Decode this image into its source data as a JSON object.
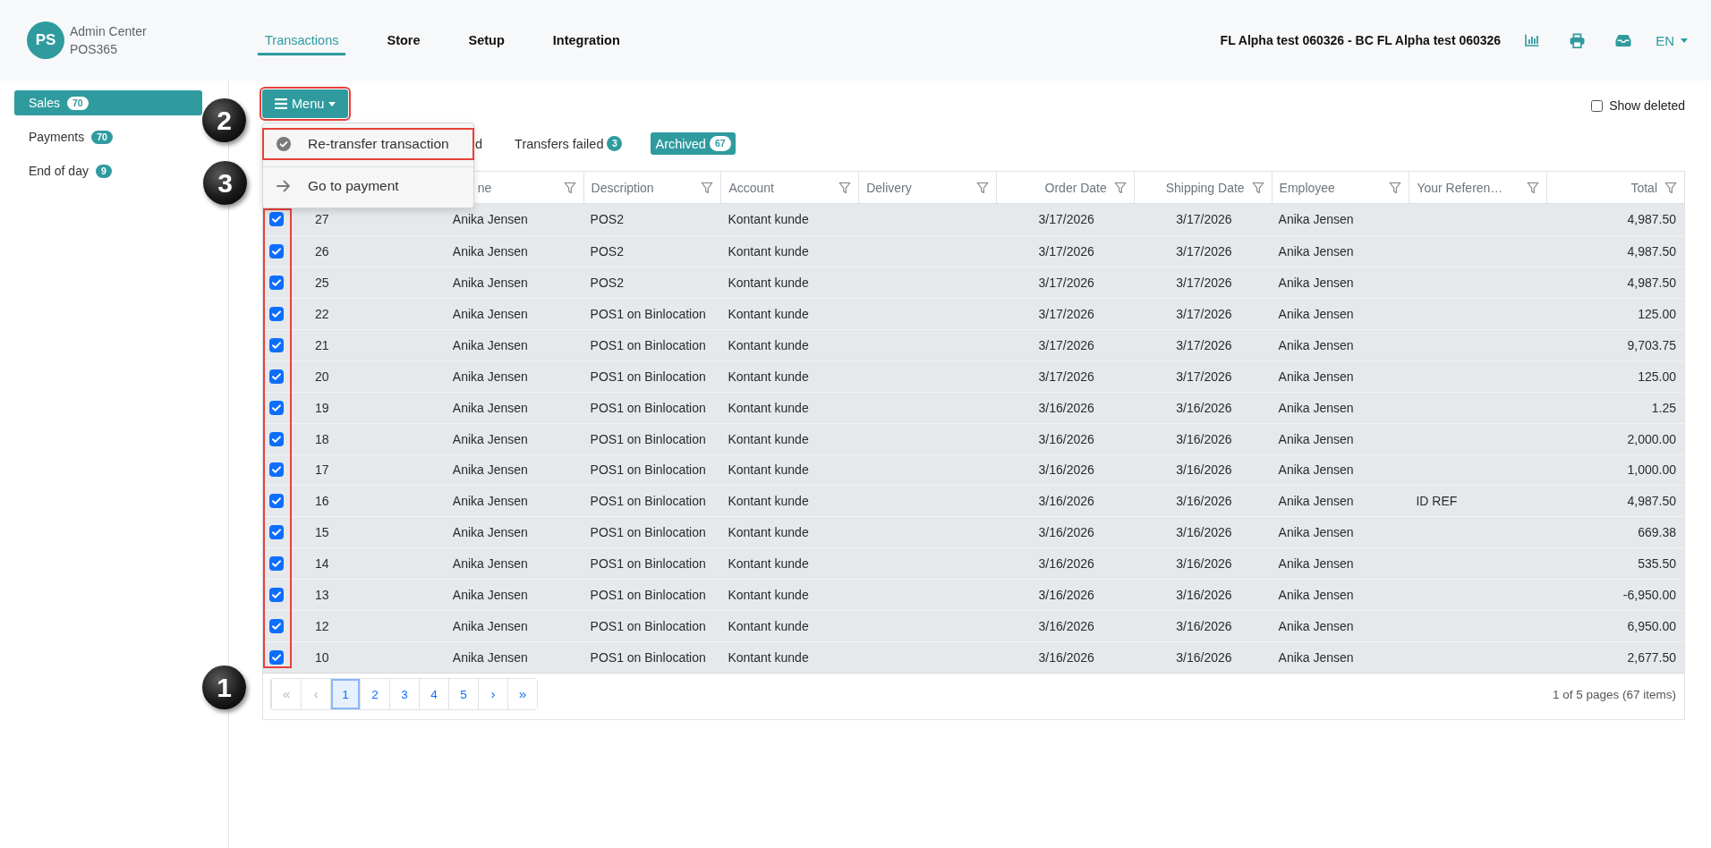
{
  "header": {
    "logo": {
      "initials": "PS",
      "title": "Admin Center",
      "subtitle": "POS365"
    },
    "nav": [
      {
        "label": "Transactions",
        "selected": true
      },
      {
        "label": "Store",
        "selected": false
      },
      {
        "label": "Setup",
        "selected": false
      },
      {
        "label": "Integration",
        "selected": false
      }
    ],
    "company": "FL Alpha test 060326 - BC FL Alpha test 060326",
    "language": "EN"
  },
  "sidebar": {
    "items": [
      {
        "label": "Sales",
        "count": "70",
        "selected": true
      },
      {
        "label": "Payments",
        "count": "70",
        "selected": false
      },
      {
        "label": "End of day",
        "count": "9",
        "selected": false
      }
    ]
  },
  "toolbar": {
    "menu_button": {
      "label": "Menu",
      "highlighted": true
    },
    "show_deleted": {
      "label": "Show deleted",
      "checked": false
    }
  },
  "menu": {
    "items": [
      {
        "kind": "confirm",
        "label": "Re-transfer transaction",
        "highlighted": true
      },
      {
        "kind": "navigate",
        "label": "Go to payment",
        "highlighted": false
      }
    ]
  },
  "tabs": [
    {
      "label": "d",
      "selected": false
    },
    {
      "label": "Transfers failed",
      "count": "3",
      "selected": false
    },
    {
      "label": "Archived",
      "count": "67",
      "selected": true
    }
  ],
  "table": {
    "columns": [
      {
        "label": "ne"
      },
      {
        "label": "Description"
      },
      {
        "label": "Account"
      },
      {
        "label": "Delivery"
      },
      {
        "label": "Order Date"
      },
      {
        "label": "Shipping Date"
      },
      {
        "label": "Employee"
      },
      {
        "label": "Your Referen…"
      },
      {
        "label": "Total"
      }
    ],
    "selection_highlighted": true,
    "rows": [
      {
        "checked": true,
        "column_2": "27",
        "column_3": "Anika Jensen",
        "description": "POS2",
        "account": "Kontant kunde",
        "order_date": "3/17/2026",
        "shipping_date": "3/17/2026",
        "employee": "Anika Jensen",
        "total": "4,987.50"
      },
      {
        "checked": true,
        "column_2": "26",
        "column_3": "Anika Jensen",
        "description": "POS2",
        "account": "Kontant kunde",
        "order_date": "3/17/2026",
        "shipping_date": "3/17/2026",
        "employee": "Anika Jensen",
        "total": "4,987.50"
      },
      {
        "checked": true,
        "column_2": "25",
        "column_3": "Anika Jensen",
        "description": "POS2",
        "account": "Kontant kunde",
        "order_date": "3/17/2026",
        "shipping_date": "3/17/2026",
        "employee": "Anika Jensen",
        "total": "4,987.50"
      },
      {
        "checked": true,
        "column_2": "22",
        "column_3": "Anika Jensen",
        "description": "POS1 on Binlocation",
        "account": "Kontant kunde",
        "order_date": "3/17/2026",
        "shipping_date": "3/17/2026",
        "employee": "Anika Jensen",
        "total": "125.00"
      },
      {
        "checked": true,
        "column_2": "21",
        "column_3": "Anika Jensen",
        "description": "POS1 on Binlocation",
        "account": "Kontant kunde",
        "order_date": "3/17/2026",
        "shipping_date": "3/17/2026",
        "employee": "Anika Jensen",
        "total": "9,703.75"
      },
      {
        "checked": true,
        "column_2": "20",
        "column_3": "Anika Jensen",
        "description": "POS1 on Binlocation",
        "account": "Kontant kunde",
        "order_date": "3/17/2026",
        "shipping_date": "3/17/2026",
        "employee": "Anika Jensen",
        "total": "125.00"
      },
      {
        "checked": true,
        "column_2": "19",
        "column_3": "Anika Jensen",
        "description": "POS1 on Binlocation",
        "account": "Kontant kunde",
        "order_date": "3/16/2026",
        "shipping_date": "3/16/2026",
        "employee": "Anika Jensen",
        "total": "1.25"
      },
      {
        "checked": true,
        "column_2": "18",
        "column_3": "Anika Jensen",
        "description": "POS1 on Binlocation",
        "account": "Kontant kunde",
        "order_date": "3/16/2026",
        "shipping_date": "3/16/2026",
        "employee": "Anika Jensen",
        "total": "2,000.00"
      },
      {
        "checked": true,
        "column_2": "17",
        "column_3": "Anika Jensen",
        "description": "POS1 on Binlocation",
        "account": "Kontant kunde",
        "order_date": "3/16/2026",
        "shipping_date": "3/16/2026",
        "employee": "Anika Jensen",
        "total": "1,000.00"
      },
      {
        "checked": true,
        "column_2": "16",
        "column_3": "Anika Jensen",
        "description": "POS1 on Binlocation",
        "account": "Kontant kunde",
        "order_date": "3/16/2026",
        "shipping_date": "3/16/2026",
        "employee": "Anika Jensen",
        "your_reference": "ID REF",
        "total": "4,987.50"
      },
      {
        "checked": true,
        "column_2": "15",
        "column_3": "Anika Jensen",
        "description": "POS1 on Binlocation",
        "account": "Kontant kunde",
        "order_date": "3/16/2026",
        "shipping_date": "3/16/2026",
        "employee": "Anika Jensen",
        "total": "669.38"
      },
      {
        "checked": true,
        "column_2": "14",
        "column_3": "Anika Jensen",
        "description": "POS1 on Binlocation",
        "account": "Kontant kunde",
        "order_date": "3/16/2026",
        "shipping_date": "3/16/2026",
        "employee": "Anika Jensen",
        "total": "535.50"
      },
      {
        "checked": true,
        "column_2": "13",
        "column_3": "Anika Jensen",
        "description": "POS1 on Binlocation",
        "account": "Kontant kunde",
        "order_date": "3/16/2026",
        "shipping_date": "3/16/2026",
        "employee": "Anika Jensen",
        "total": "-6,950.00"
      },
      {
        "checked": true,
        "column_2": "12",
        "column_3": "Anika Jensen",
        "description": "POS1 on Binlocation",
        "account": "Kontant kunde",
        "order_date": "3/16/2026",
        "shipping_date": "3/16/2026",
        "employee": "Anika Jensen",
        "total": "6,950.00"
      },
      {
        "checked": true,
        "column_2": "10",
        "column_3": "Anika Jensen",
        "description": "POS1 on Binlocation",
        "account": "Kontant kunde",
        "order_date": "3/16/2026",
        "shipping_date": "3/16/2026",
        "employee": "Anika Jensen",
        "total": "2,677.50"
      }
    ]
  },
  "pagination": {
    "items": [
      {
        "kind": "first",
        "label": "«",
        "selected": false,
        "disabled": true
      },
      {
        "kind": "previous",
        "label": "‹",
        "selected": false,
        "disabled": true
      },
      {
        "kind": "page",
        "label": "1",
        "selected": true,
        "disabled": false
      },
      {
        "kind": "page",
        "label": "2",
        "selected": false,
        "disabled": false
      },
      {
        "kind": "page",
        "label": "3",
        "selected": false,
        "disabled": false
      },
      {
        "kind": "page",
        "label": "4",
        "selected": false,
        "disabled": false
      },
      {
        "kind": "page",
        "label": "5",
        "selected": false,
        "disabled": false
      },
      {
        "kind": "next",
        "label": "›",
        "selected": false,
        "disabled": false
      },
      {
        "kind": "last",
        "label": "»",
        "selected": false,
        "disabled": false
      }
    ],
    "summary": "1 of 5 pages (67 items)"
  },
  "callouts": [
    "2",
    "3",
    "1"
  ]
}
